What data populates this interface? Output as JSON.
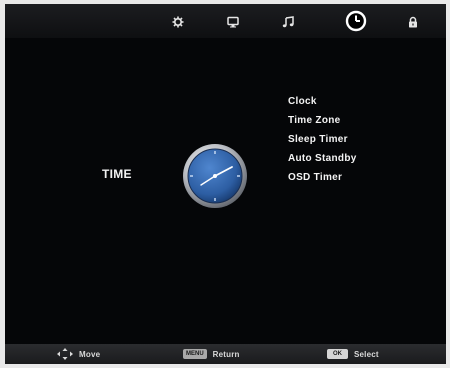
{
  "tabs": [
    {
      "icon": "gear-icon",
      "active": false
    },
    {
      "icon": "monitor-icon",
      "active": false
    },
    {
      "icon": "music-note-icon",
      "active": false
    },
    {
      "icon": "clock-icon",
      "active": true
    },
    {
      "icon": "lock-icon",
      "active": false
    }
  ],
  "page": {
    "title": "TIME"
  },
  "menu": {
    "items": [
      {
        "label": "Clock"
      },
      {
        "label": "Time Zone"
      },
      {
        "label": "Sleep Timer"
      },
      {
        "label": "Auto Standby"
      },
      {
        "label": "OSD Timer"
      }
    ]
  },
  "footer": {
    "move_label": "Move",
    "menu_key": "MENU",
    "return_label": "Return",
    "ok_key": "OK",
    "select_label": "Select"
  },
  "colors": {
    "background": "#050608",
    "clock_face": "#2d5ea3",
    "text": "#f4f4f4"
  }
}
